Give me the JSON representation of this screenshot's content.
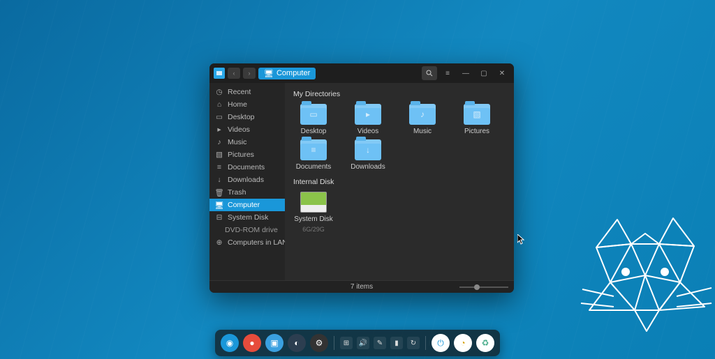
{
  "breadcrumb": {
    "label": "Computer"
  },
  "sidebar": {
    "items": [
      {
        "label": "Recent",
        "icon": "clock"
      },
      {
        "label": "Home",
        "icon": "home"
      },
      {
        "label": "Desktop",
        "icon": "desktop"
      },
      {
        "label": "Videos",
        "icon": "video"
      },
      {
        "label": "Music",
        "icon": "music"
      },
      {
        "label": "Pictures",
        "icon": "picture"
      },
      {
        "label": "Documents",
        "icon": "document"
      },
      {
        "label": "Downloads",
        "icon": "download"
      },
      {
        "label": "Trash",
        "icon": "trash"
      },
      {
        "label": "Computer",
        "icon": "computer",
        "active": true
      },
      {
        "label": "System Disk",
        "icon": "disk"
      },
      {
        "label": "DVD-ROM drive",
        "icon": "",
        "indent": true
      },
      {
        "label": "Computers in LAN",
        "icon": "network"
      }
    ]
  },
  "main": {
    "sections": [
      {
        "title": "My Directories",
        "items": [
          {
            "label": "Desktop",
            "glyph": "▭"
          },
          {
            "label": "Videos",
            "glyph": "▸"
          },
          {
            "label": "Music",
            "glyph": "♪"
          },
          {
            "label": "Pictures",
            "glyph": "▧"
          },
          {
            "label": "Documents",
            "glyph": "≡"
          },
          {
            "label": "Downloads",
            "glyph": "↓"
          }
        ]
      },
      {
        "title": "Internal Disk",
        "items": [
          {
            "label": "System Disk",
            "sub": "6G/29G",
            "type": "disk"
          }
        ]
      }
    ]
  },
  "status": {
    "count": "7 items"
  },
  "taskbar": {
    "apps": [
      {
        "name": "launcher",
        "bg": "#1a97d9",
        "glyph": "◉"
      },
      {
        "name": "record",
        "bg": "#e74c3c",
        "glyph": "●"
      },
      {
        "name": "files",
        "bg": "#3aa0e0",
        "glyph": "▣"
      },
      {
        "name": "browser",
        "bg": "#2c3e50",
        "glyph": "◐"
      },
      {
        "name": "settings",
        "bg": "#333",
        "glyph": "⚙"
      }
    ],
    "tray": [
      {
        "name": "grid",
        "glyph": "⊞"
      },
      {
        "name": "volume",
        "glyph": "🔊"
      },
      {
        "name": "edit",
        "glyph": "✎"
      },
      {
        "name": "battery",
        "glyph": "▮"
      },
      {
        "name": "refresh",
        "glyph": "↻"
      }
    ],
    "right": [
      {
        "name": "power",
        "bg": "#fff",
        "color": "#1a97d9",
        "glyph": "⏻"
      },
      {
        "name": "monitor",
        "bg": "#fff",
        "color": "#d4a000",
        "glyph": "◔"
      },
      {
        "name": "trash",
        "bg": "#fff",
        "color": "#4a8",
        "glyph": "♻"
      }
    ]
  }
}
